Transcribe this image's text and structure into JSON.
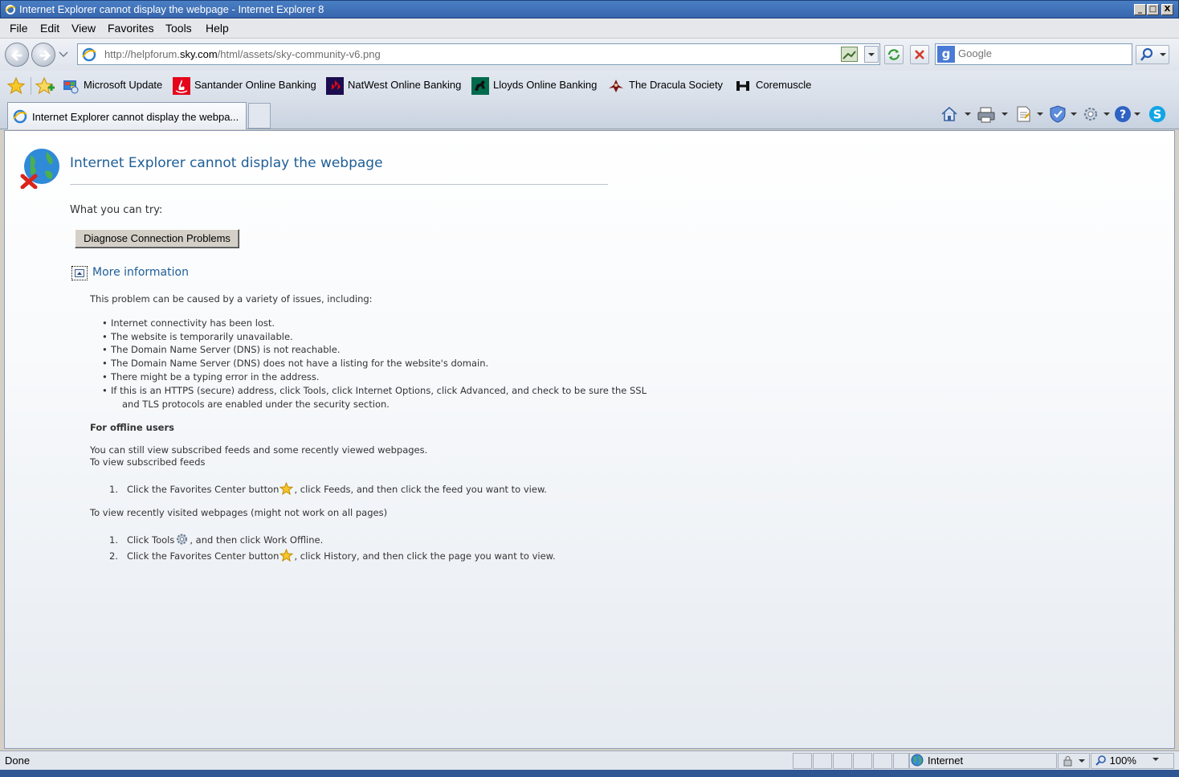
{
  "window": {
    "title": "Internet Explorer cannot display the webpage - Internet Explorer 8",
    "controls": {
      "minimize": "_",
      "maximize": "□",
      "close": "X"
    }
  },
  "menu": [
    "File",
    "Edit",
    "View",
    "Favorites",
    "Tools",
    "Help"
  ],
  "address": {
    "url_prefix": "http://helpforum.",
    "url_domain": "sky.com",
    "url_suffix": "/html/assets/sky-community-v6.png"
  },
  "search": {
    "placeholder": "Google",
    "provider_letter": "g"
  },
  "favorites": [
    {
      "label": "Microsoft Update",
      "icon": "windows-update-icon"
    },
    {
      "label": "Santander Online Banking",
      "icon": "santander-flame-icon"
    },
    {
      "label": "NatWest Online Banking",
      "icon": "natwest-logo-icon"
    },
    {
      "label": "Lloyds Online Banking",
      "icon": "lloyds-horse-icon"
    },
    {
      "label": "The Dracula Society",
      "icon": "dracula-icon"
    },
    {
      "label": "Coremuscle",
      "icon": "dumbbell-icon"
    }
  ],
  "tab": {
    "label": "Internet Explorer cannot display the webpa..."
  },
  "page": {
    "heading": "Internet Explorer cannot display the webpage",
    "try_label": "What you can try:",
    "diagnose_button": "Diagnose Connection Problems",
    "more_info": "More information",
    "problem_intro": "This problem can be caused by a variety of issues, including:",
    "causes": [
      "Internet connectivity has been lost.",
      "The website is temporarily unavailable.",
      "The Domain Name Server (DNS) is not reachable.",
      "The Domain Name Server (DNS) does not have a listing for the website's domain.",
      "There might be a typing error in the address.",
      "If this is an HTTPS (secure) address, click Tools, click Internet Options, click Advanced, and check to be sure the SSL",
      "and TLS protocols are enabled under the security section."
    ],
    "offline_heading": "For offline users",
    "offline_text1": "You can still view subscribed feeds and some recently viewed webpages.",
    "offline_text2": "To view subscribed feeds",
    "feeds_step_num": "1.",
    "feeds_step_a": "Click the Favorites Center button",
    "feeds_step_b": ", click Feeds, and then click the feed you want to view.",
    "recent_intro": "To view recently visited webpages (might not work on all pages)",
    "recent_step1_num": "1.",
    "recent_step1_a": "Click Tools",
    "recent_step1_b": ", and then click Work Offline.",
    "recent_step2_num": "2.",
    "recent_step2_a": "Click the Favorites Center button",
    "recent_step2_b": ", click History, and then click the page you want to view."
  },
  "status": {
    "text": "Done",
    "zone": "Internet",
    "zoom": "100%"
  },
  "colors": {
    "titlebar": "#3766ad",
    "link_blue": "#1f5e96",
    "menu_bg": "#e6e7ea"
  }
}
